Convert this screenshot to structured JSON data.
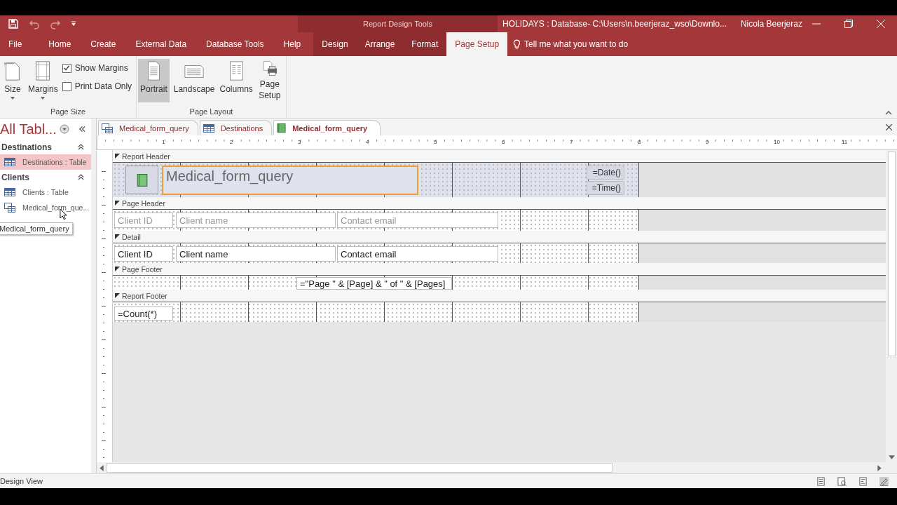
{
  "title_bar": {
    "context_label": "Report Design Tools",
    "title": "HOLIDAYS : Database- C:\\Users\\n.beerjeraz_wso\\Downlo...",
    "user": "Nicola Beerjeraz"
  },
  "ribbon_tabs": [
    {
      "label": "File",
      "selected": false,
      "contextual": false
    },
    {
      "label": "Home",
      "selected": false,
      "contextual": false
    },
    {
      "label": "Create",
      "selected": false,
      "contextual": false
    },
    {
      "label": "External Data",
      "selected": false,
      "contextual": false
    },
    {
      "label": "Database Tools",
      "selected": false,
      "contextual": false
    },
    {
      "label": "Help",
      "selected": false,
      "contextual": false
    },
    {
      "label": "Design",
      "selected": false,
      "contextual": true
    },
    {
      "label": "Arrange",
      "selected": false,
      "contextual": true
    },
    {
      "label": "Format",
      "selected": false,
      "contextual": true
    },
    {
      "label": "Page Setup",
      "selected": true,
      "contextual": true
    }
  ],
  "tell_me": "Tell me what you want to do",
  "ribbon_groups": [
    {
      "label": "Page Size",
      "items": [
        {
          "kind": "button",
          "label": "Size",
          "selected": false,
          "dropdown": true
        },
        {
          "kind": "button",
          "label": "Margins",
          "selected": false,
          "dropdown": true
        },
        {
          "kind": "checkboxes",
          "checks": [
            {
              "label": "Show Margins",
              "checked": true
            },
            {
              "label": "Print Data Only",
              "checked": false
            }
          ]
        }
      ]
    },
    {
      "label": "Page Layout",
      "items": [
        {
          "kind": "button",
          "label": "Portrait",
          "selected": true,
          "dropdown": false
        },
        {
          "kind": "button",
          "label": "Landscape",
          "selected": false,
          "dropdown": false
        },
        {
          "kind": "button",
          "label": "Columns",
          "selected": false,
          "dropdown": false
        },
        {
          "kind": "button",
          "label": "Page Setup",
          "selected": false,
          "dropdown": false
        }
      ]
    }
  ],
  "nav_pane": {
    "title": "All Tabl...",
    "groups": [
      {
        "label": "Destinations",
        "expanded": true,
        "items": [
          {
            "label": "Destinations : Table",
            "kind": "table",
            "selected": true
          }
        ]
      },
      {
        "label": "Clients",
        "expanded": true,
        "items": [
          {
            "label": "Clients : Table",
            "kind": "table",
            "selected": false
          },
          {
            "label": "Medical_form_que...",
            "kind": "query",
            "selected": false
          }
        ]
      }
    ],
    "tooltip": "Medical_form_query"
  },
  "doc_tabs": [
    {
      "label": "Medical_form_query",
      "kind": "query",
      "selected": false
    },
    {
      "label": "Destinations",
      "kind": "table",
      "selected": false
    },
    {
      "label": "Medical_form_query",
      "kind": "report",
      "selected": true
    }
  ],
  "ruler": [
    "1",
    "2",
    "3",
    "4",
    "5",
    "6",
    "7",
    "8",
    "9",
    "10",
    "11"
  ],
  "sections": [
    {
      "label": "Report Header",
      "controls": [
        {
          "kind": "logo"
        },
        {
          "kind": "title",
          "text": "Medical_form_query",
          "selected": true
        },
        {
          "kind": "textbox",
          "text": "=Date()"
        },
        {
          "kind": "textbox",
          "text": "=Time()"
        }
      ]
    },
    {
      "label": "Page Header",
      "controls": [
        {
          "kind": "label",
          "text": "Client ID"
        },
        {
          "kind": "label",
          "text": "Client name"
        },
        {
          "kind": "label",
          "text": "Contact email"
        }
      ]
    },
    {
      "label": "Detail",
      "controls": [
        {
          "kind": "textbox",
          "text": "Client ID"
        },
        {
          "kind": "textbox",
          "text": "Client name"
        },
        {
          "kind": "textbox",
          "text": "Contact email"
        }
      ]
    },
    {
      "label": "Page Footer",
      "controls": [
        {
          "kind": "textbox",
          "text": "=\"Page \" & [Page] & \" of \" & [Pages]"
        }
      ]
    },
    {
      "label": "Report Footer",
      "controls": [
        {
          "kind": "textbox",
          "text": "=Count(*)"
        }
      ]
    }
  ],
  "status_bar": {
    "text": "Design View"
  }
}
